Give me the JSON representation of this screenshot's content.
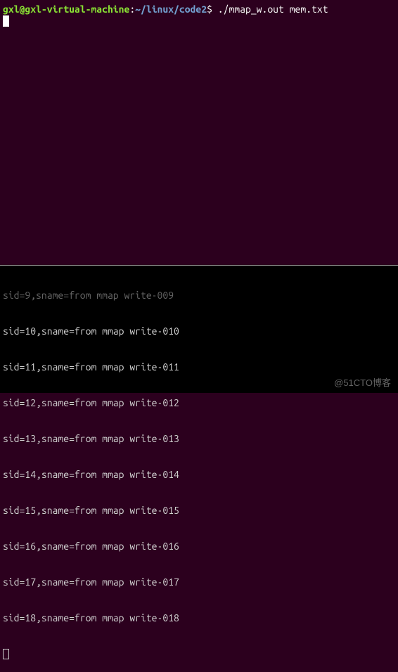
{
  "prompt": {
    "user_host": "gxl@gxl-virtual-machine",
    "colon": ":",
    "path": "~/linux/code2",
    "dollar": "$ ",
    "command": "./mmap_w.out mem.txt"
  },
  "faded_line": "sid=9,sname=from mmap write-009",
  "output_lines": [
    "sid=10,sname=from mmap write-010",
    "sid=11,sname=from mmap write-011",
    "sid=12,sname=from mmap write-012",
    "sid=13,sname=from mmap write-013",
    "sid=14,sname=from mmap write-014",
    "sid=15,sname=from mmap write-015",
    "sid=16,sname=from mmap write-016",
    "sid=17,sname=from mmap write-017",
    "sid=18,sname=from mmap write-018"
  ],
  "watermark": "@51CTO博客"
}
